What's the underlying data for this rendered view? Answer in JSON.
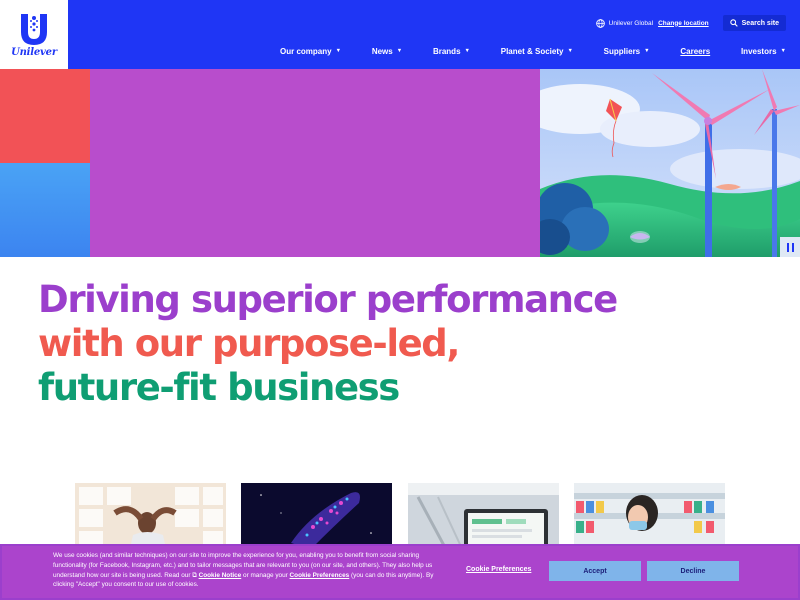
{
  "brand": {
    "name": "Unilever",
    "logo_word": "Unilever"
  },
  "utility": {
    "region_icon": "globe-icon",
    "region_text": "Unilever Global",
    "change_location": "Change location",
    "search_icon": "search-icon",
    "search_label": "Search site"
  },
  "nav": {
    "items": [
      {
        "label": "Our company",
        "caret": "▼"
      },
      {
        "label": "News",
        "caret": "▼"
      },
      {
        "label": "Brands",
        "caret": "▼"
      },
      {
        "label": "Planet & Society",
        "caret": "▼"
      },
      {
        "label": "Suppliers",
        "caret": "▼"
      },
      {
        "label": "Careers",
        "caret": ""
      },
      {
        "label": "Investors",
        "caret": "▼"
      }
    ]
  },
  "hero": {
    "pause_icon": "pause-icon"
  },
  "headline": {
    "line1": "Driving superior performance",
    "line2": "with our purpose-led,",
    "line3": "future-fit business"
  },
  "cookie": {
    "text_1": "We use cookies (and similar techniques) on our site to improve the experience for you, enabling you to benefit from social sharing functionality (for Facebook, Instagram, etc.) and to tailor messages that are relevant to you (on our site, and others). They also help us understand how our site is being used. Read our ",
    "notice_link": "Cookie Notice",
    "text_2": " or manage your ",
    "preferences_link": "Cookie Preferences",
    "text_3": " (you can do this anytime). By clicking \"Accept\" you consent to our use of cookies.",
    "preferences_button": "Cookie Preferences",
    "accept_button": "Accept",
    "decline_button": "Decline"
  },
  "colors": {
    "header_blue": "#1f36f5",
    "hero_red": "#f25256",
    "hero_purple": "#b84dcc",
    "headline_purple": "#9b3fcc",
    "headline_coral": "#f05a4f",
    "headline_green": "#0f9e73",
    "cookie_purple": "#ab44cc",
    "button_blue": "#7fb4ea"
  }
}
